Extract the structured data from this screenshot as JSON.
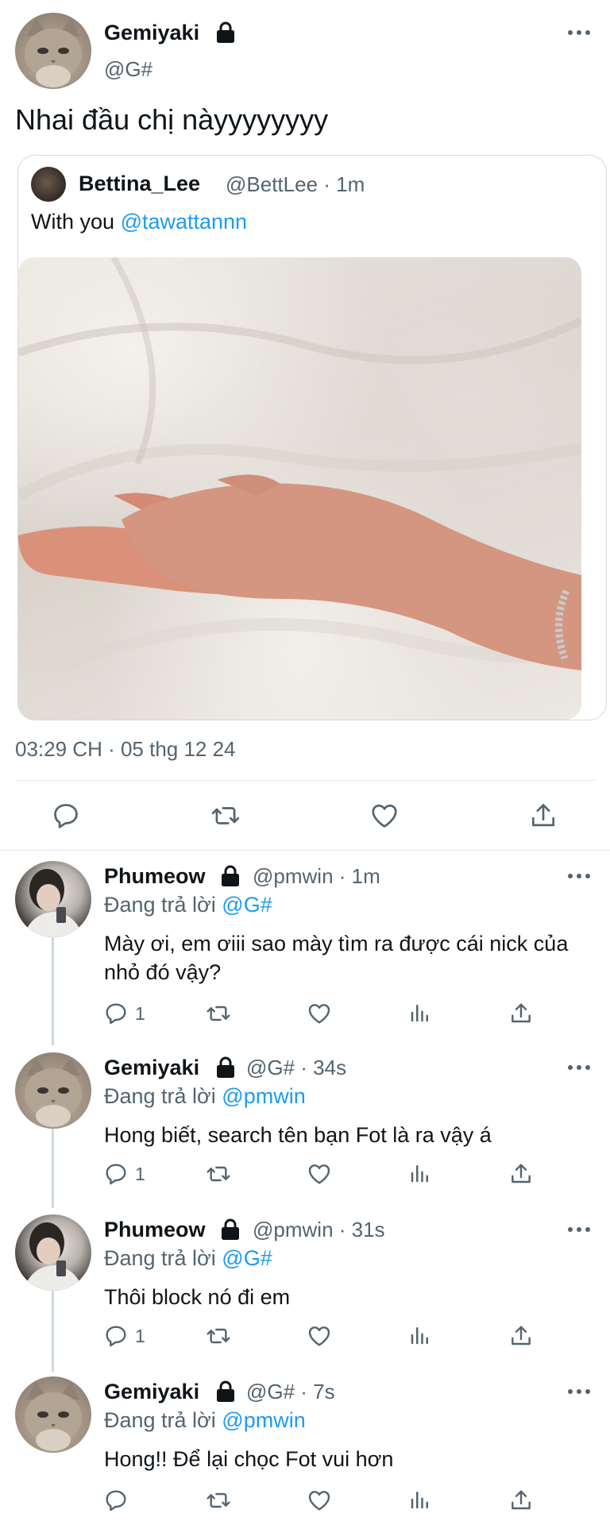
{
  "main_tweet": {
    "name": "Gemiyaki",
    "handle": "@G#",
    "text": "Nhai đầu chị nàyyyyyyyy",
    "timestamp": "03:29 CH · 05 thg 12 24",
    "icons": [
      "lock-icon",
      "more-icon",
      "reply-icon",
      "retweet-icon",
      "like-icon",
      "share-icon"
    ]
  },
  "quoted_tweet": {
    "name": "Bettina_Lee",
    "handle_time": "@BettLee · 1m",
    "text_prefix": "With you",
    "mention": "@tawattannn",
    "image": "photo of two hands on white bedsheets"
  },
  "replies": [
    {
      "name": "Phumeow",
      "meta": "@pmwin · 1m",
      "replying_label": "Đang trả lời",
      "replying_to": "@G#",
      "text": "Mày ơi, em ơiii sao mày tìm ra được cái nick của nhỏ đó vậy?",
      "reply_count": "1",
      "avatar": "boy"
    },
    {
      "name": "Gemiyaki",
      "meta": "@G# · 34s",
      "replying_label": "Đang trả lời",
      "replying_to": "@pmwin",
      "text": "Hong biết, search tên bạn Fot là ra vậy á",
      "reply_count": "1",
      "avatar": "cat"
    },
    {
      "name": "Phumeow",
      "meta": "@pmwin · 31s",
      "replying_label": "Đang trả lời",
      "replying_to": "@G#",
      "text": "Thôi block nó đi em",
      "reply_count": "1",
      "avatar": "boy"
    },
    {
      "name": "Gemiyaki",
      "meta": "@G# · 7s",
      "replying_label": "Đang trả lời",
      "replying_to": "@pmwin",
      "text": "Hong!! Để lại chọc Fot vui hơn",
      "reply_count": "",
      "avatar": "cat"
    }
  ],
  "colors": {
    "accent": "#1d9bf0",
    "secondary_text": "#536471",
    "divider": "#e1e6e9"
  }
}
